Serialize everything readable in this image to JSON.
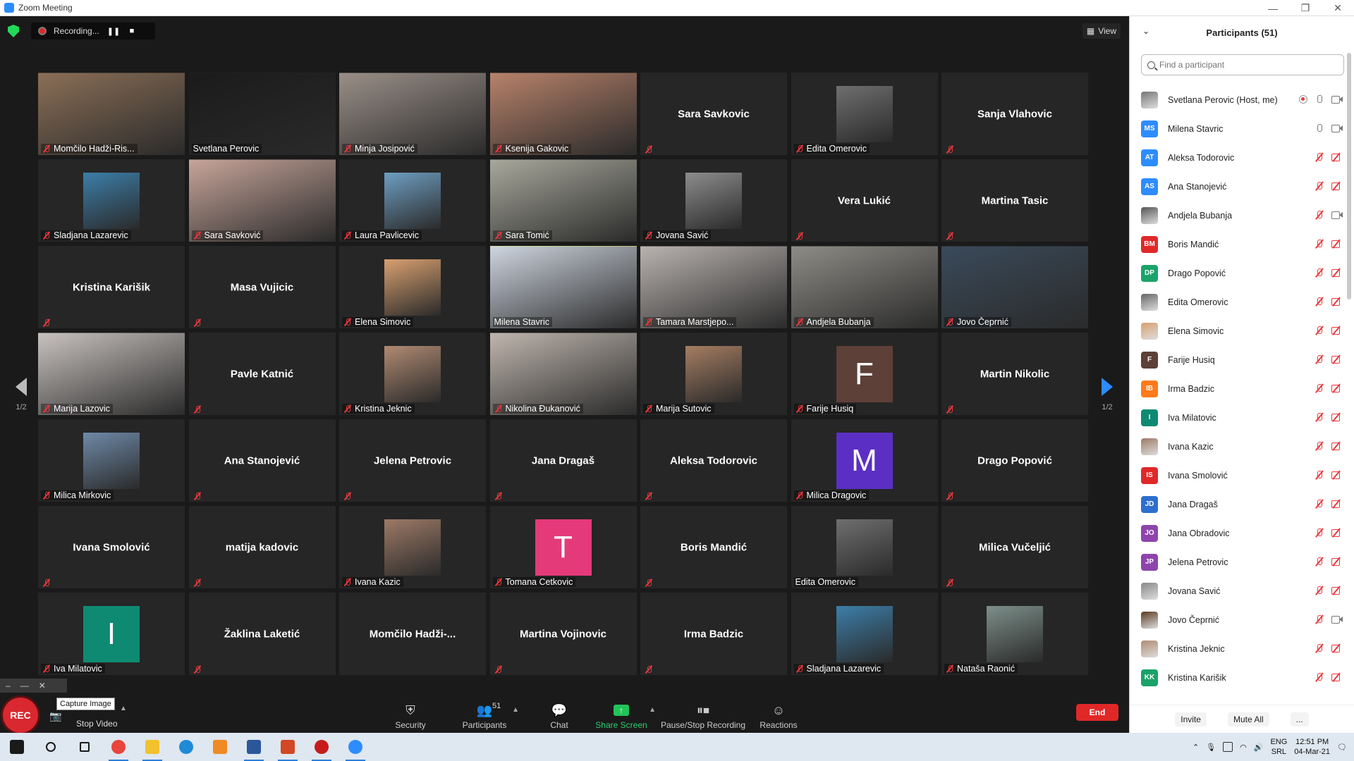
{
  "window": {
    "title": "Zoom Meeting",
    "minimize": "—",
    "restore": "❐",
    "close": "✕"
  },
  "topbar": {
    "recording_label": "Recording...",
    "pause_icon": "pause-icon",
    "stop_icon": "stop-icon",
    "view_label": "View"
  },
  "pager": {
    "left_label": "1/2",
    "right_label": "1/2"
  },
  "tiles": [
    {
      "name": "Momčilo Hadži-Ris...",
      "type": "video",
      "bg": "#8b6f57",
      "muted": true
    },
    {
      "name": "Svetlana Perovic",
      "type": "video",
      "bg": "#1b1b1b",
      "muted": false
    },
    {
      "name": "Minja Josipović",
      "type": "video",
      "bg": "#9a8f88",
      "muted": true
    },
    {
      "name": "Ksenija Gakovic",
      "type": "video",
      "bg": "#b8826a",
      "muted": true
    },
    {
      "name": "Sara Savkovic",
      "type": "name",
      "muted": true
    },
    {
      "name": "Edita Omerovic",
      "type": "photo",
      "bg": "#6f6f6f",
      "muted": true
    },
    {
      "name": "Sanja Vlahovic",
      "type": "name",
      "muted": true
    },
    {
      "name": "Sladjana Lazarevic",
      "type": "photo",
      "bg": "#3c7ea8",
      "muted": true
    },
    {
      "name": "Sara Savković",
      "type": "video",
      "bg": "#c7a59a",
      "muted": true
    },
    {
      "name": "Laura Pavlicevic",
      "type": "photo",
      "bg": "#6e9ec2",
      "muted": true
    },
    {
      "name": "Sara Tomić",
      "type": "video",
      "bg": "#a8a89c",
      "muted": true
    },
    {
      "name": "Jovana Savić",
      "type": "photo",
      "bg": "#8d8d8d",
      "muted": true
    },
    {
      "name": "Vera Lukić",
      "type": "name",
      "muted": true
    },
    {
      "name": "Martina Tasic",
      "type": "name",
      "muted": true
    },
    {
      "name": "Kristina Karišik",
      "type": "name",
      "muted": true
    },
    {
      "name": "Masa Vujicic",
      "type": "name",
      "muted": true
    },
    {
      "name": "Elena Simovic",
      "type": "photo",
      "bg": "#d8a070",
      "muted": true
    },
    {
      "name": "Milena Stavric",
      "type": "video",
      "bg": "#cfd6e0",
      "muted": false,
      "active": true
    },
    {
      "name": "Tamara Marstjepo...",
      "type": "video",
      "bg": "#b9b3b0",
      "muted": true
    },
    {
      "name": "Andjela Bubanja",
      "type": "video",
      "bg": "#8e8c86",
      "muted": true
    },
    {
      "name": "Jovo Čeprnić",
      "type": "video",
      "bg": "#3a4a5a",
      "muted": true
    },
    {
      "name": "Marija Lazovic",
      "type": "video",
      "bg": "#c9c3c0",
      "muted": true
    },
    {
      "name": "Pavle Katnić",
      "type": "name",
      "muted": true
    },
    {
      "name": "Kristina Jeknic",
      "type": "photo",
      "bg": "#b08a72",
      "muted": true
    },
    {
      "name": "Nikolina Đukanović",
      "type": "video",
      "bg": "#bfb6ae",
      "muted": true
    },
    {
      "name": "Marija Sutovic",
      "type": "photo",
      "bg": "#a57d62",
      "muted": true
    },
    {
      "name": "Farije Husiq",
      "type": "letter",
      "letter": "F",
      "bg": "#5d4037",
      "muted": true
    },
    {
      "name": "Martin Nikolic",
      "type": "name",
      "muted": true
    },
    {
      "name": "Milica Mirkovic",
      "type": "photo",
      "bg": "#6f8aa8",
      "muted": true
    },
    {
      "name": "Ana Stanojević",
      "type": "name",
      "muted": true
    },
    {
      "name": "Jelena Petrovic",
      "type": "name",
      "muted": true
    },
    {
      "name": "Jana Dragaš",
      "type": "name",
      "muted": true
    },
    {
      "name": "Aleksa Todorovic",
      "type": "name",
      "muted": true
    },
    {
      "name": "Milica Dragovic",
      "type": "letter",
      "letter": "M",
      "bg": "#5b2fc4",
      "muted": true
    },
    {
      "name": "Drago Popović",
      "type": "name",
      "muted": true
    },
    {
      "name": "Ivana Smolović",
      "type": "name",
      "muted": true
    },
    {
      "name": "matija kadovic",
      "type": "name",
      "muted": true
    },
    {
      "name": "Ivana Kazic",
      "type": "photo",
      "bg": "#9d7a66",
      "muted": true
    },
    {
      "name": "Tomana Cetkovic",
      "type": "letter",
      "letter": "T",
      "bg": "#e43a7a",
      "muted": true
    },
    {
      "name": "Boris Mandić",
      "type": "name",
      "muted": true
    },
    {
      "name": "Edita Omerovic",
      "type": "photo",
      "bg": "#6f6f6f",
      "muted": false
    },
    {
      "name": "Milica Vučeljić",
      "type": "name",
      "muted": true
    },
    {
      "name": "Iva Milatovic",
      "type": "letter",
      "letter": "I",
      "bg": "#0f8a72",
      "muted": true
    },
    {
      "name": "Žaklina Laketić",
      "type": "name",
      "muted": true
    },
    {
      "name": "Momčilo  Hadži-...",
      "type": "name",
      "muted": false
    },
    {
      "name": "Martina Vojinovic",
      "type": "name",
      "muted": true
    },
    {
      "name": "Irma Badzic",
      "type": "name",
      "muted": true
    },
    {
      "name": "Sladjana Lazarevic",
      "type": "photo",
      "bg": "#3c7ea8",
      "muted": true
    },
    {
      "name": "Nataša Raonić",
      "type": "photo",
      "bg": "#7d8f8a",
      "muted": true
    }
  ],
  "toolbar": {
    "security": "Security",
    "participants": "Participants",
    "participants_count": "51",
    "chat": "Chat",
    "share_screen": "Share Screen",
    "pause_stop_recording": "Pause/Stop Recording",
    "reactions": "Reactions",
    "end": "End",
    "stop_video": "Stop Video",
    "rec": "REC",
    "capture_tooltip": "Capture Image"
  },
  "panel": {
    "title": "Participants (51)",
    "search_placeholder": "Find a participant",
    "invite": "Invite",
    "mute_all": "Mute All",
    "more": "...",
    "participants": [
      {
        "name": "Svetlana Perovic (Host, me)",
        "initials": "",
        "color": "#777777",
        "photo": true,
        "mic": "on",
        "cam": "on",
        "rec": true
      },
      {
        "name": "Milena Stavric",
        "initials": "MS",
        "color": "#2d8cff",
        "photo": false,
        "mic": "on",
        "cam": "on"
      },
      {
        "name": "Aleksa Todorovic",
        "initials": "AT",
        "color": "#2d8cff",
        "photo": false,
        "mic": "off",
        "cam": "off"
      },
      {
        "name": "Ana Stanojević",
        "initials": "AS",
        "color": "#2d8cff",
        "photo": false,
        "mic": "off",
        "cam": "off"
      },
      {
        "name": "Andjela Bubanja",
        "initials": "",
        "color": "#555555",
        "photo": true,
        "mic": "off",
        "cam": "on"
      },
      {
        "name": "Boris Mandić",
        "initials": "BM",
        "color": "#e02828",
        "photo": false,
        "mic": "off",
        "cam": "off"
      },
      {
        "name": "Drago Popović",
        "initials": "DP",
        "color": "#1aa36a",
        "photo": false,
        "mic": "off",
        "cam": "off"
      },
      {
        "name": "Edita Omerovic",
        "initials": "",
        "color": "#666666",
        "photo": true,
        "mic": "off",
        "cam": "off"
      },
      {
        "name": "Elena Simovic",
        "initials": "",
        "color": "#d8a070",
        "photo": true,
        "mic": "off",
        "cam": "off"
      },
      {
        "name": "Farije Husiq",
        "initials": "F",
        "color": "#5d4037",
        "photo": false,
        "mic": "off",
        "cam": "off"
      },
      {
        "name": "Irma Badzic",
        "initials": "IB",
        "color": "#ff7a1a",
        "photo": false,
        "mic": "off",
        "cam": "off"
      },
      {
        "name": "Iva Milatovic",
        "initials": "I",
        "color": "#0f8a72",
        "photo": false,
        "mic": "off",
        "cam": "off"
      },
      {
        "name": "Ivana Kazic",
        "initials": "",
        "color": "#9d7a66",
        "photo": true,
        "mic": "off",
        "cam": "off"
      },
      {
        "name": "Ivana Smolović",
        "initials": "IS",
        "color": "#e02828",
        "photo": false,
        "mic": "off",
        "cam": "off"
      },
      {
        "name": "Jana Dragaš",
        "initials": "JD",
        "color": "#2d6fcf",
        "photo": false,
        "mic": "off",
        "cam": "off"
      },
      {
        "name": "Jana Obradovic",
        "initials": "JO",
        "color": "#8e44ad",
        "photo": false,
        "mic": "off",
        "cam": "off"
      },
      {
        "name": "Jelena Petrovic",
        "initials": "JP",
        "color": "#8e44ad",
        "photo": false,
        "mic": "off",
        "cam": "off"
      },
      {
        "name": "Jovana Savić",
        "initials": "",
        "color": "#888888",
        "photo": true,
        "mic": "off",
        "cam": "off"
      },
      {
        "name": "Jovo Čeprnić",
        "initials": "",
        "color": "#5a3a20",
        "photo": true,
        "mic": "off",
        "cam": "on"
      },
      {
        "name": "Kristina Jeknic",
        "initials": "",
        "color": "#b08a72",
        "photo": true,
        "mic": "off",
        "cam": "off"
      },
      {
        "name": "Kristina Karišik",
        "initials": "KK",
        "color": "#1aa36a",
        "photo": false,
        "mic": "off",
        "cam": "off"
      }
    ]
  },
  "taskbar": {
    "lang_top": "ENG",
    "lang_bottom": "SRL",
    "time": "12:51 PM",
    "date": "04-Mar-21",
    "apps": [
      {
        "name": "start-icon",
        "color": "#1a1a1a"
      },
      {
        "name": "search-icon",
        "color": "#1a1a1a"
      },
      {
        "name": "task-view-icon",
        "color": "#1a1a1a"
      },
      {
        "name": "chrome-icon",
        "color": "#e8453c"
      },
      {
        "name": "explorer-icon",
        "color": "#f2c12e"
      },
      {
        "name": "edge-icon",
        "color": "#1f8ad6"
      },
      {
        "name": "app-orange-icon",
        "color": "#f08a24"
      },
      {
        "name": "word-icon",
        "color": "#2b579a"
      },
      {
        "name": "powerpoint-icon",
        "color": "#d24726"
      },
      {
        "name": "record-app-icon",
        "color": "#c71b1b"
      },
      {
        "name": "zoom-icon",
        "color": "#2d8cff"
      }
    ]
  }
}
